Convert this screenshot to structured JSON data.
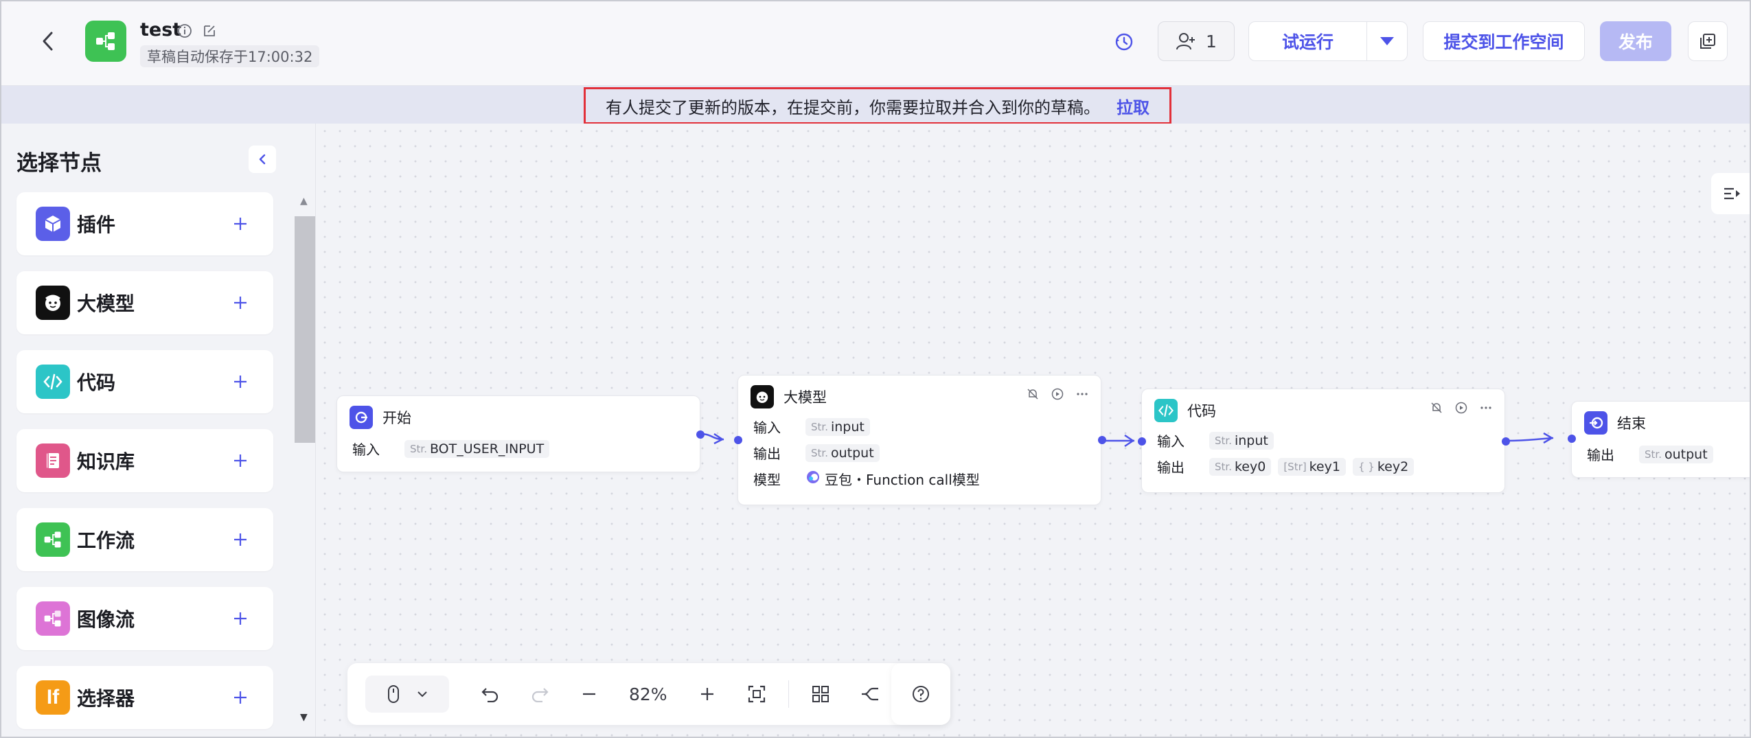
{
  "header": {
    "title": "test",
    "autosave": "草稿自动保存于17:00:32",
    "collaborators_count": "1",
    "run_label": "试运行",
    "submit_label": "提交到工作空间",
    "publish_label": "发布"
  },
  "banner": {
    "message": "有人提交了更新的版本，在提交前，你需要拉取并合入到你的草稿。",
    "link_label": "拉取"
  },
  "sidebar": {
    "title": "选择节点",
    "items": [
      {
        "label": "插件",
        "icon": "plugin-icon",
        "color": "#5b5fe8"
      },
      {
        "label": "大模型",
        "icon": "llm-icon",
        "color": "#111111"
      },
      {
        "label": "代码",
        "icon": "code-icon",
        "color": "#2cc5c7"
      },
      {
        "label": "知识库",
        "icon": "knowledge-icon",
        "color": "#e0578a"
      },
      {
        "label": "工作流",
        "icon": "workflow-icon",
        "color": "#3ec254"
      },
      {
        "label": "图像流",
        "icon": "imageflow-icon",
        "color": "#dd74d6"
      },
      {
        "label": "选择器",
        "icon": "selector-icon",
        "color": "#f59b16"
      }
    ]
  },
  "canvas": {
    "nodes": {
      "start": {
        "title": "开始",
        "input_label": "输入",
        "input_type": "Str.",
        "input_value": "BOT_USER_INPUT"
      },
      "llm": {
        "title": "大模型",
        "input_label": "输入",
        "input_type": "Str.",
        "input_value": "input",
        "output_label": "输出",
        "output_type": "Str.",
        "output_value": "output",
        "model_label": "模型",
        "model_value": "豆包・Function call模型"
      },
      "code": {
        "title": "代码",
        "input_label": "输入",
        "input_type": "Str.",
        "input_value": "input",
        "output_label": "输出",
        "out1_type": "Str.",
        "out1": "key0",
        "out2_type": "[Str]",
        "out2": "key1",
        "out3_type": "{ }",
        "out3": "key2"
      },
      "end": {
        "title": "结束",
        "output_label": "输出",
        "output_type": "Str.",
        "output_value": "output"
      }
    }
  },
  "toolbar": {
    "zoom": "82%"
  },
  "colors": {
    "accent": "#4d53e8",
    "publish_disabled": "#b6b9f4",
    "banner_border": "#e2303a"
  }
}
